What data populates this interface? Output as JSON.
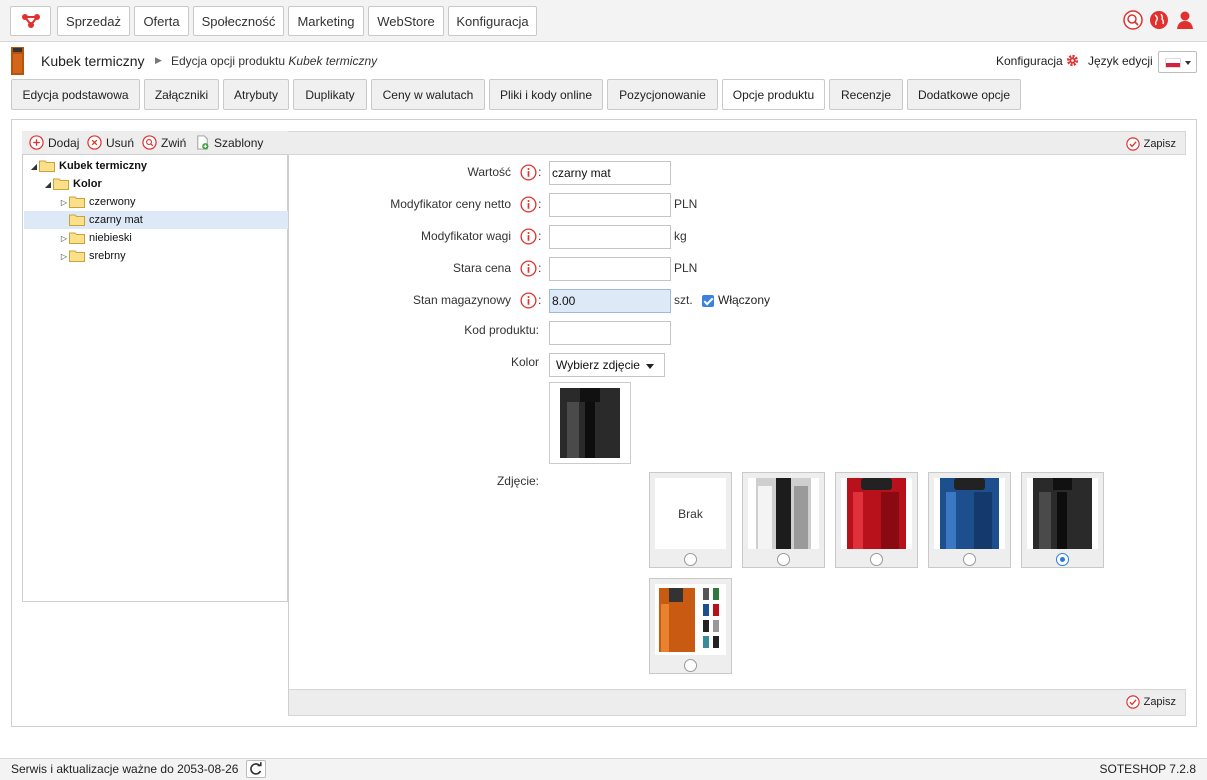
{
  "topnav": {
    "items": [
      "Sprzedaż",
      "Oferta",
      "Społeczność",
      "Marketing",
      "WebStore",
      "Konfiguracja"
    ]
  },
  "header": {
    "product_name": "Kubek termiczny",
    "breadcrumb_prefix": "Edycja opcji produktu",
    "breadcrumb_product": "Kubek termiczny",
    "config_link": "Konfiguracja",
    "lang_label": "Język edycji"
  },
  "tabs": [
    "Edycja podstawowa",
    "Załączniki",
    "Atrybuty",
    "Duplikaty",
    "Ceny w walutach",
    "Pliki i kody online",
    "Pozycjonowanie",
    "Opcje produktu",
    "Recenzje",
    "Dodatkowe opcje"
  ],
  "active_tab": "Opcje produktu",
  "tree_toolbar": {
    "add": "Dodaj",
    "remove": "Usuń",
    "collapse": "Zwiń",
    "templates": "Szablony"
  },
  "tree": {
    "root": "Kubek termiczny",
    "group": "Kolor",
    "items": [
      "czerwony",
      "czarny mat",
      "niebieski",
      "srebrny"
    ],
    "selected": "czarny mat"
  },
  "form": {
    "save_label": "Zapisz",
    "value_label": "Wartość",
    "value": "czarny mat",
    "price_mod_label": "Modyfikator ceny netto",
    "price_mod": "",
    "price_unit": "PLN",
    "weight_mod_label": "Modyfikator wagi",
    "weight_mod": "",
    "weight_unit": "kg",
    "old_price_label": "Stara cena",
    "old_price": "",
    "old_price_unit": "PLN",
    "stock_label": "Stan magazynowy",
    "stock": "8.00",
    "stock_unit": "szt.",
    "enabled_label": "Włączony",
    "enabled": true,
    "code_label": "Kod produktu:",
    "code": "",
    "color_label": "Kolor",
    "color_select": "Wybierz zdjęcie",
    "photo_label": "Zdjęcie:",
    "photo_none": "Brak",
    "photos": [
      "Brak",
      "silver",
      "red",
      "blue",
      "black",
      "orange-collage"
    ],
    "selected_photo": "black"
  },
  "status": {
    "service_text": "Serwis i aktualizacje ważne do 2053-08-26",
    "version": "SOTESHOP 7.2.8"
  },
  "colors": {
    "accent_red": "#e0312f",
    "selection_blue": "#dde9f7",
    "radio_blue": "#2a7ae0"
  }
}
